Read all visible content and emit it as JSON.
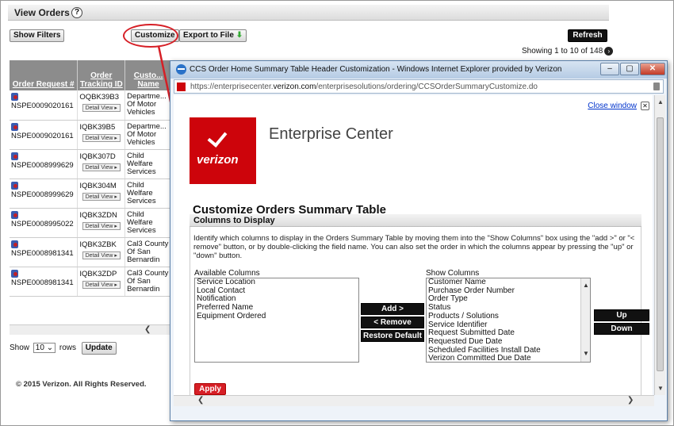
{
  "page": {
    "title": "View Orders",
    "help_icon": "?",
    "show_filters_label": "Show Filters",
    "customize_label": "Customize",
    "export_label": "Export to File",
    "refresh_label": "Refresh",
    "showing_text": "Showing 1 to 10 of 148",
    "show_label": "Show",
    "rows_per_page": "10",
    "rows_label": "rows",
    "update_label": "Update",
    "copyright": "© 2015 Verizon. All Rights Reserved.",
    "annotation_color": "#d61f26"
  },
  "table": {
    "columns": [
      "Order Request #",
      "Order Tracking ID",
      "Custo... Name"
    ],
    "detail_label": "Detail View ▸",
    "rows": [
      {
        "request": "NSPE0009020161",
        "tracking": "OQBK39B3",
        "customer": "Departme... Of Motor Vehicles"
      },
      {
        "request": "NSPE0009020161",
        "tracking": "IQBK39B5",
        "customer": "Departme... Of Motor Vehicles"
      },
      {
        "request": "NSPE0008999629",
        "tracking": "IQBK307D",
        "customer": "Child Welfare Services"
      },
      {
        "request": "NSPE0008999629",
        "tracking": "IQBK304M",
        "customer": "Child Welfare Services"
      },
      {
        "request": "NSPE0008995022",
        "tracking": "IQBK3ZDN",
        "customer": "Child Welfare Services"
      },
      {
        "request": "NSPE0008981341",
        "tracking": "IQBK3ZBK",
        "customer": "Cal3 County Of San Bernardin"
      },
      {
        "request": "NSPE0008981341",
        "tracking": "IQBK3ZDP",
        "customer": "Cal3 County Of San Bernardin"
      }
    ]
  },
  "popup": {
    "window_title": "CCS Order Home Summary Table Header Customization - Windows Internet Explorer provided by Verizon",
    "url_prefix": "https://enterprisecenter.",
    "url_domain": "verizon.com",
    "url_suffix": "/enterprisesolutions/ordering/CCSOrderSummaryCustomize.do",
    "close_window_label": "Close window",
    "logo_text": "verizon",
    "enterprise_title": "Enterprise Center",
    "heading": "Customize Orders Summary Table",
    "section_title": "Columns to Display",
    "description": "Identify which columns to display in the Orders Summary Table by moving them into the \"Show Columns\" box using the \"add >\" or \"< remove\" button, or by double-clicking the field name. You can also set the order in which the columns appear by pressing the \"up\" or \"down\" button.",
    "available_label": "Available Columns",
    "available_columns": [
      "Service Location",
      "Local Contact",
      "Notification",
      "Preferred Name",
      "Equipment Ordered"
    ],
    "show_label": "Show Columns",
    "show_columns": [
      "Customer Name",
      "Purchase Order Number",
      "Order Type",
      "Status",
      "Products / Solutions",
      "Service Identifier",
      "Request Submitted Date",
      "Requested Due Date",
      "Scheduled Facilities Install Date",
      "Verizon Committed Due Date"
    ],
    "add_label": "Add >",
    "remove_label": "< Remove",
    "restore_label": "Restore Default",
    "up_label": "Up",
    "down_label": "Down",
    "apply_label": "Apply",
    "brand_color": "#cd040b"
  }
}
